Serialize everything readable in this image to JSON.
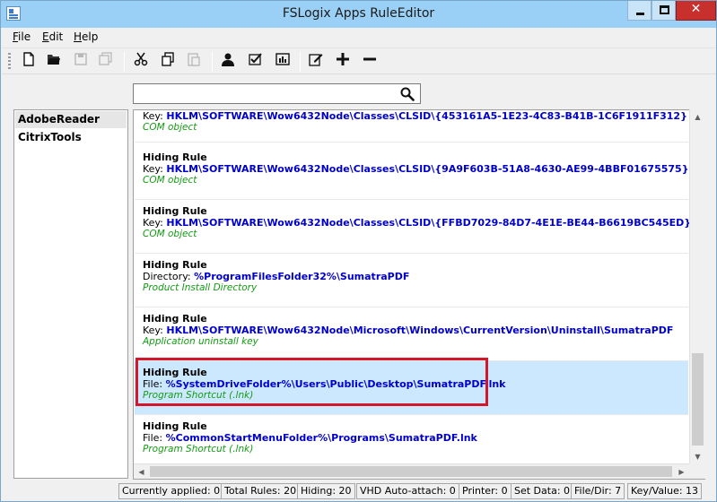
{
  "window": {
    "title": "FSLogix Apps RuleEditor"
  },
  "menu": [
    {
      "label": "File",
      "accel": "F",
      "rest": "ile"
    },
    {
      "label": "Edit",
      "accel": "E",
      "rest": "dit"
    },
    {
      "label": "Help",
      "accel": "H",
      "rest": "elp"
    }
  ],
  "toolbar": {
    "icons": [
      "new-file-icon",
      "open-folder-icon",
      "save-icon",
      "save-all-icon",
      "cut-icon",
      "copy-icon",
      "paste-icon",
      "user-icon",
      "check-icon",
      "report-icon",
      "edit-icon",
      "add-icon",
      "remove-icon"
    ]
  },
  "search": {
    "value": "",
    "placeholder": ""
  },
  "rule_sets": [
    {
      "label": "AdobeReader",
      "selected": true
    },
    {
      "label": "CitrixTools",
      "selected": false
    }
  ],
  "rules": [
    {
      "title": "",
      "kind": "Key:",
      "path": "HKLM\\SOFTWARE\\Wow6432Node\\Classes\\CLSID\\{453161A5-1E23-4C83-B41B-1C6F1911F312}",
      "note": "COM object",
      "partial": true
    },
    {
      "title": "Hiding Rule",
      "kind": "Key:",
      "path": "HKLM\\SOFTWARE\\Wow6432Node\\Classes\\CLSID\\{9A9F603B-51A8-4630-AE99-4BBF01675575}",
      "note": "COM object"
    },
    {
      "title": "Hiding Rule",
      "kind": "Key:",
      "path": "HKLM\\SOFTWARE\\Wow6432Node\\Classes\\CLSID\\{FFBD7029-84D7-4E1E-BE44-B6619BC545ED}",
      "note": "COM object"
    },
    {
      "title": "Hiding Rule",
      "kind": "Directory:",
      "path": "%ProgramFilesFolder32%\\SumatraPDF",
      "note": "Product Install Directory"
    },
    {
      "title": "Hiding Rule",
      "kind": "Key:",
      "path": "HKLM\\SOFTWARE\\Wow6432Node\\Microsoft\\Windows\\CurrentVersion\\Uninstall\\SumatraPDF",
      "note": "Application uninstall key"
    },
    {
      "title": "Hiding Rule",
      "kind": "File:",
      "path": "%SystemDriveFolder%\\Users\\Public\\Desktop\\SumatraPDF.lnk",
      "note": "Program Shortcut (.lnk)",
      "selected": true
    },
    {
      "title": "Hiding Rule",
      "kind": "File:",
      "path": "%CommonStartMenuFolder%\\Programs\\SumatraPDF.lnk",
      "note": "Program Shortcut (.lnk)"
    }
  ],
  "status": [
    "Currently applied: 0",
    "Total Rules: 20",
    "Hiding: 20",
    "VHD Auto-attach: 0",
    "Printer: 0",
    "Set Data: 0",
    "File/Dir: 7",
    "Key/Value: 13"
  ],
  "colors": {
    "titlebar": "#9ad0f5",
    "selection": "#cce8ff",
    "path": "#0000cc",
    "note": "#149b14",
    "highlight": "#d4162a",
    "close": "#c7302c"
  }
}
